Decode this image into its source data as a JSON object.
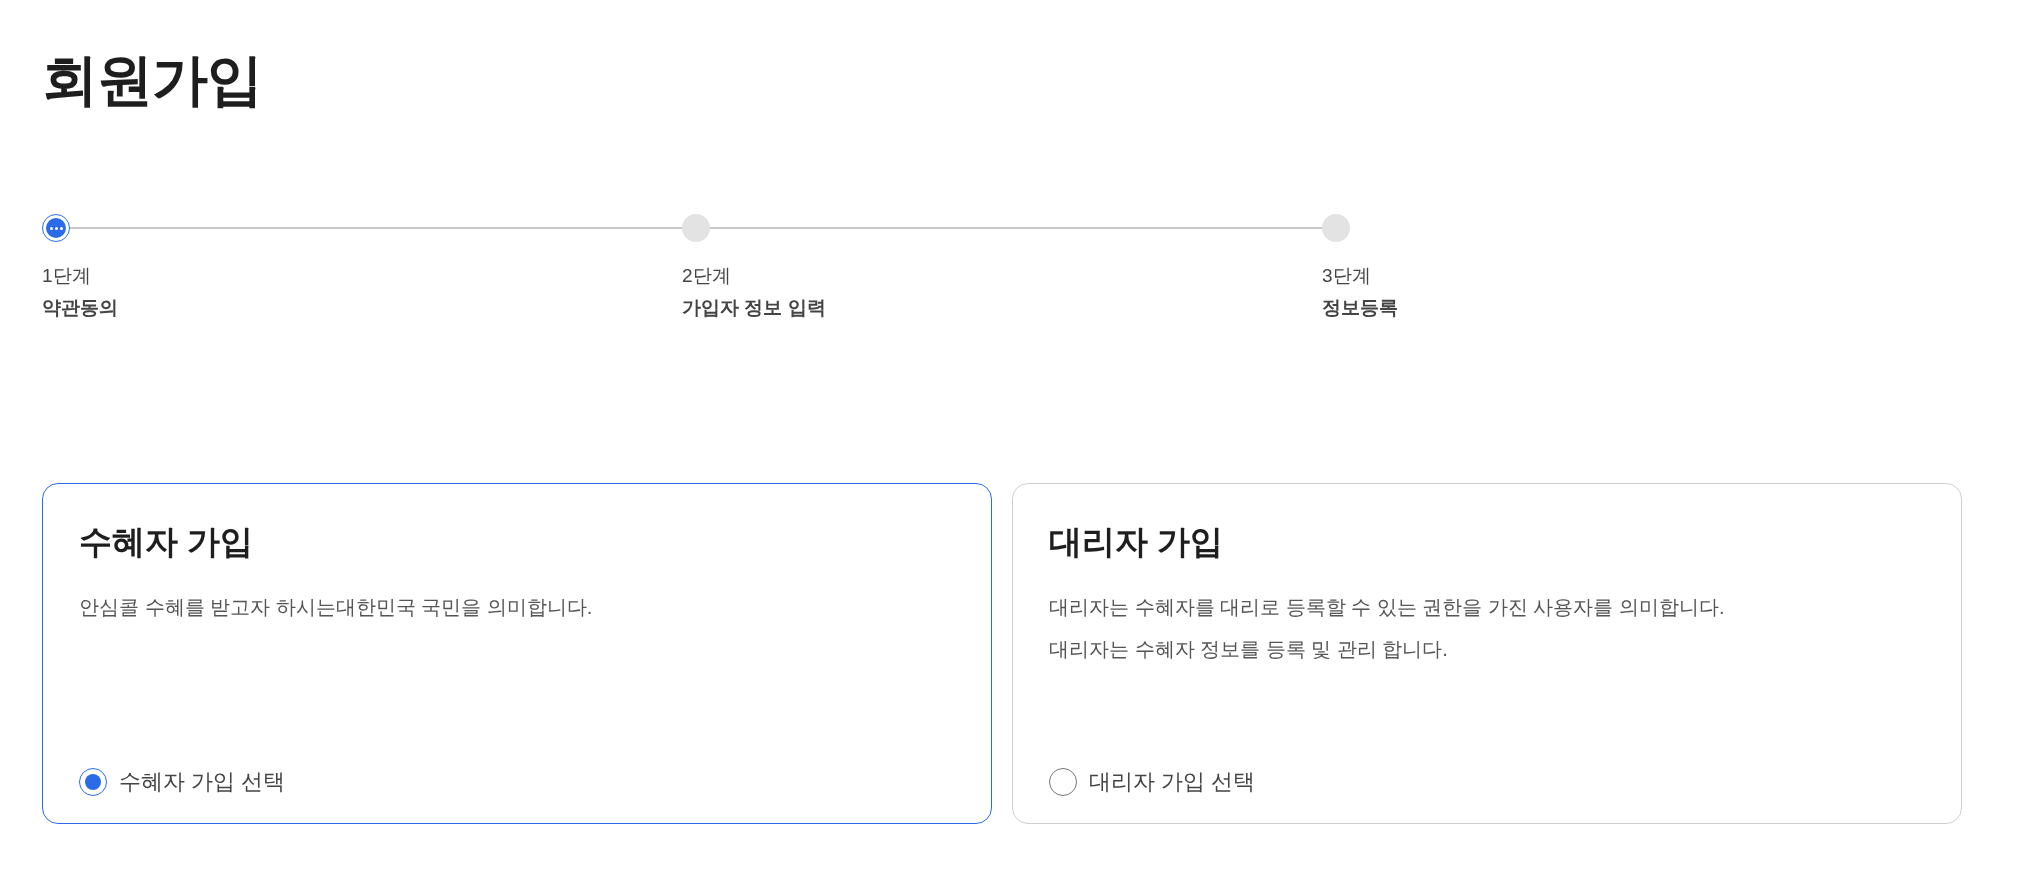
{
  "title": "회원가입",
  "steps": [
    {
      "number": "1단계",
      "label": "약관동의",
      "current": true
    },
    {
      "number": "2단계",
      "label": "가입자 정보 입력",
      "current": false
    },
    {
      "number": "3단계",
      "label": "정보등록",
      "current": false
    }
  ],
  "options": [
    {
      "title": "수혜자 가입",
      "description": [
        "안심콜 수혜를 받고자 하시는대한민국 국민을 의미합니다."
      ],
      "radio_label": "수혜자 가입 선택",
      "selected": true
    },
    {
      "title": "대리자 가입",
      "description": [
        "대리자는 수혜자를 대리로 등록할 수 있는 권한을 가진 사용자를 의미합니다.",
        "대리자는 수혜자 정보를 등록 및 관리 합니다."
      ],
      "radio_label": "대리자 가입 선택",
      "selected": false
    }
  ]
}
